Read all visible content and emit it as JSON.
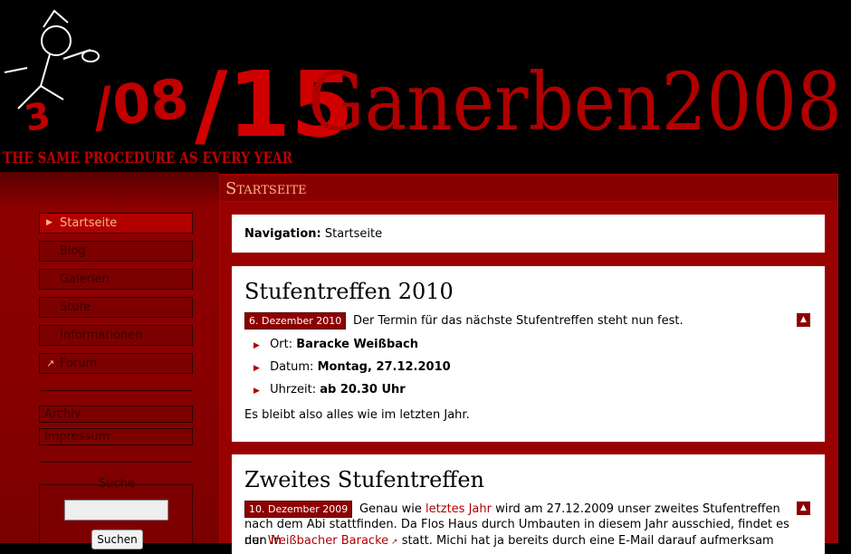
{
  "header": {
    "slogan": "THE SAME PROCEDURE AS EVERY YEAR",
    "logo_numbers": "3/08/15",
    "site_title": "Ganerben 2008"
  },
  "sidebar": {
    "nav": [
      {
        "label": "Startseite",
        "active": true
      },
      {
        "label": "Blog"
      },
      {
        "label": "Galerien"
      },
      {
        "label": "Stufe"
      },
      {
        "label": "Informationen"
      },
      {
        "label": "Forum",
        "external": true
      }
    ],
    "extra": [
      {
        "label": "Archiv"
      },
      {
        "label": "Impressum"
      }
    ],
    "search": {
      "label": "Suche",
      "button": "Suchen",
      "value": ""
    }
  },
  "main": {
    "page_title": "Startseite",
    "breadcrumb": {
      "label": "Navigation:",
      "value": "Startseite"
    },
    "posts": [
      {
        "title": "Stufentreffen 2010",
        "date": "6. Dezember 2010",
        "lead": "Der Termin für das nächste Stufentreffen steht nun fest.",
        "items": [
          {
            "key": "Ort:",
            "value": "Baracke Weißbach"
          },
          {
            "key": "Datum:",
            "value": "Montag, 27.12.2010"
          },
          {
            "key": "Uhrzeit:",
            "value": "ab 20.30 Uhr"
          }
        ],
        "footer": "Es bleibt also alles wie im letzten Jahr."
      },
      {
        "title": "Zweites Stufentreffen",
        "date": "10. Dezember 2009",
        "text_1": "Genau wie",
        "link_1": "letztes Jahr",
        "text_2": "wird am 27.12.2009 unser zweites Stufentreffen",
        "line_2": "nach dem Abi stattfinden. Da Flos Haus durch Umbauten in diesem Jahr ausschied, findet es nun in",
        "text_3": "der",
        "link_2": "Weißbacher Baracke",
        "text_4": "statt. Michi hat ja bereits durch eine E-Mail darauf aufmerksam"
      }
    ]
  },
  "colors": {
    "brand_red": "#8c0000",
    "accent_orange": "#ffb38a"
  }
}
